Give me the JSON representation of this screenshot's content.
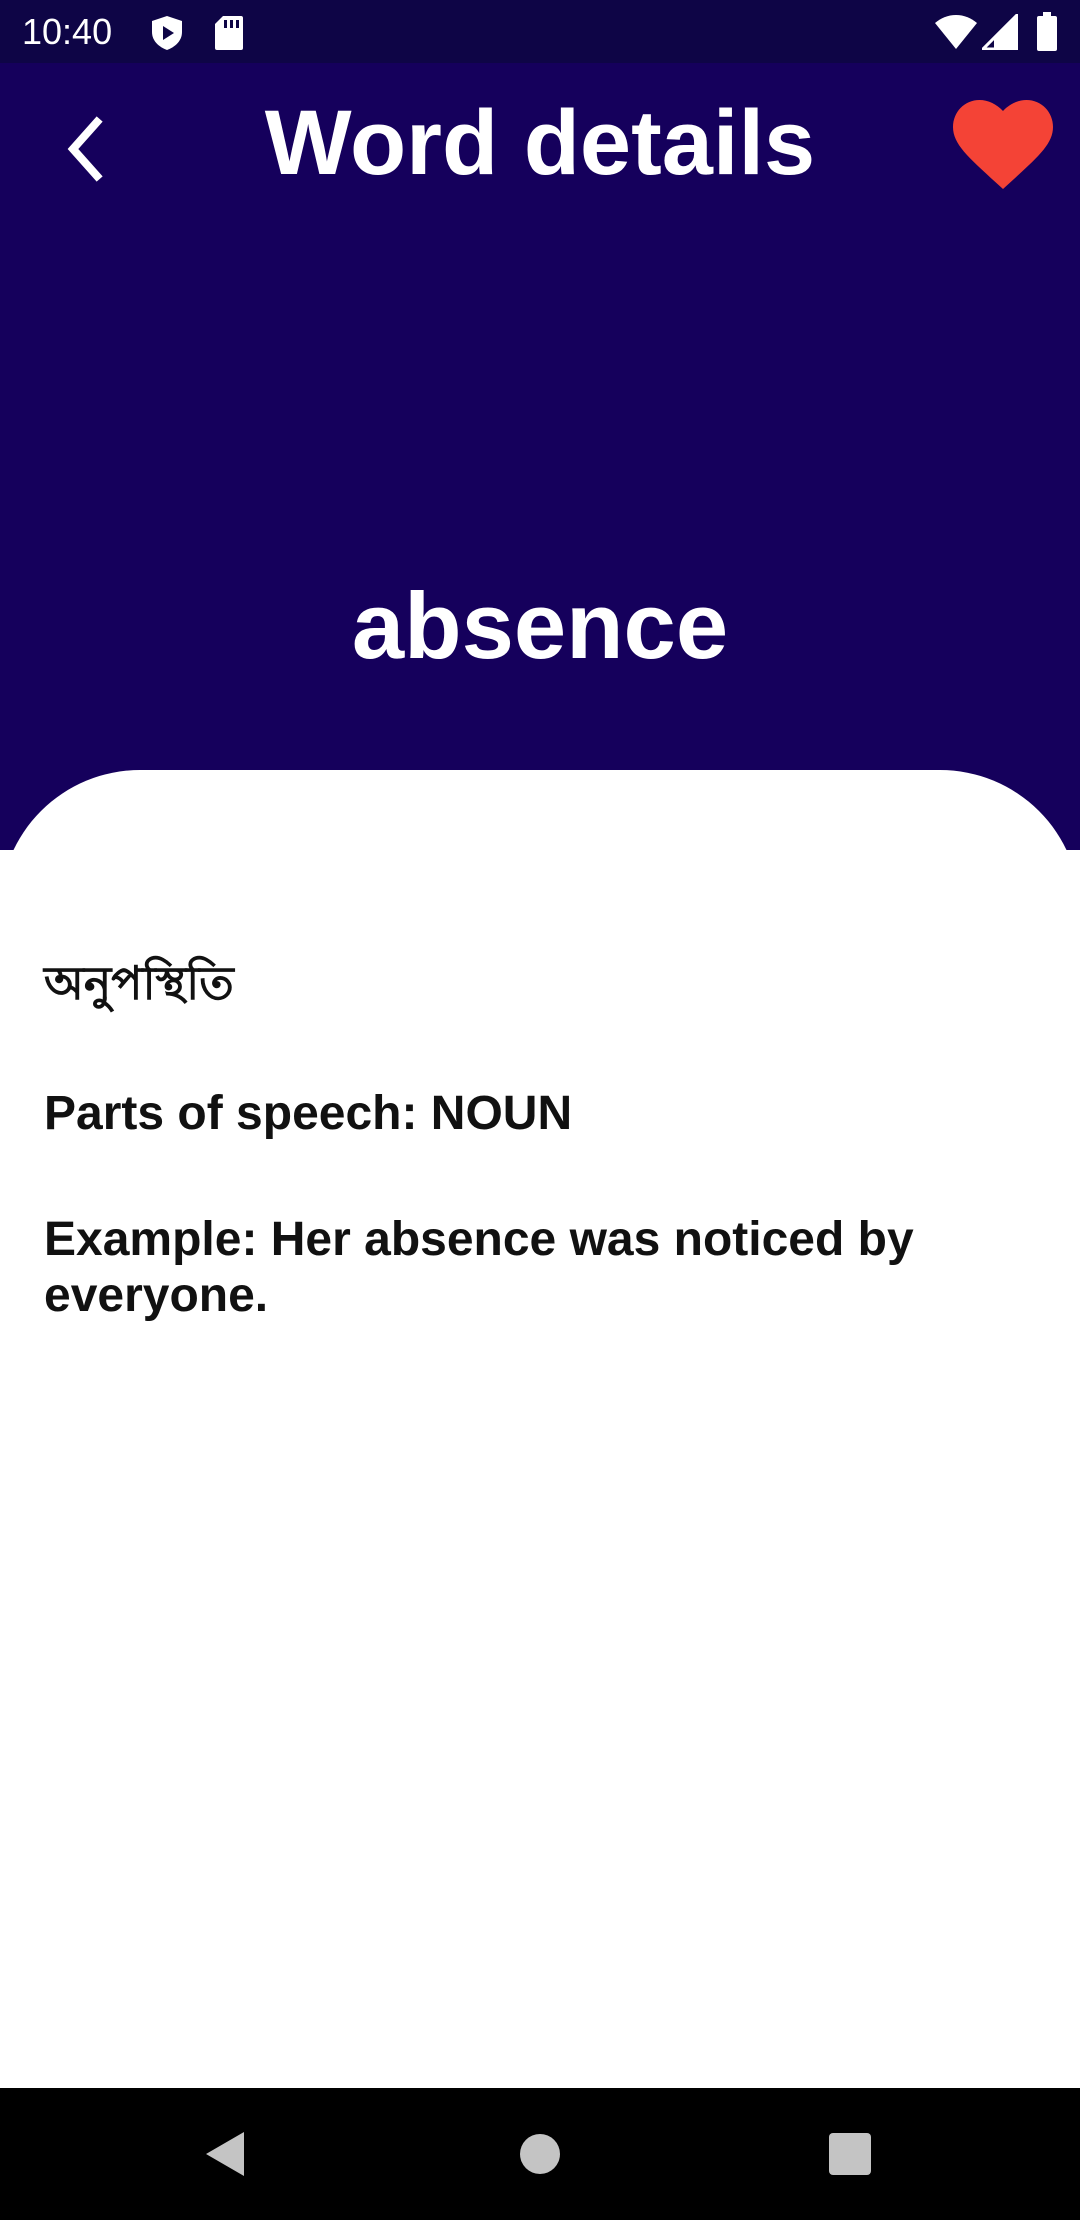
{
  "status_bar": {
    "time": "10:40",
    "left_icons": [
      "play-shield-icon",
      "sd-card-icon"
    ],
    "right_icons": [
      "wifi-icon",
      "cellular-signal-icon",
      "battery-icon"
    ]
  },
  "header": {
    "back_icon": "chevron-left-icon",
    "title": "Word details",
    "favorite_icon": "heart-icon",
    "favorite_color": "#f44336",
    "background_color": "#15005c"
  },
  "word": "absence",
  "details": {
    "translation": "অনুপস্থিতি",
    "parts_of_speech": "Parts of speech: NOUN",
    "example": "Example: Her absence was noticed by everyone."
  },
  "nav_bar": {
    "back_icon": "triangle-back-icon",
    "home_icon": "circle-home-icon",
    "recents_icon": "square-recents-icon"
  }
}
